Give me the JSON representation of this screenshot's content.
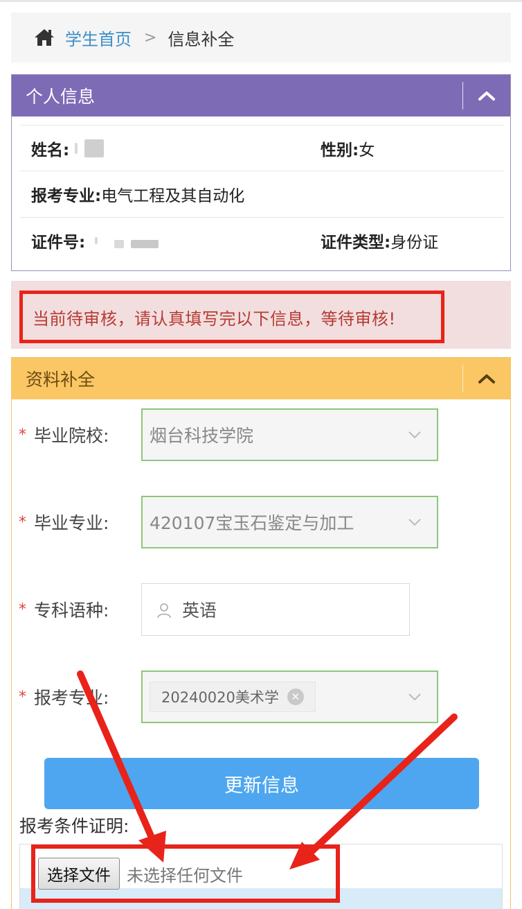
{
  "breadcrumb": {
    "home_icon": "home-icon",
    "home_label": "学生首页",
    "separator": ">",
    "current": "信息补全"
  },
  "personal_panel": {
    "title": "个人信息",
    "name_label": "姓名:",
    "gender_label": "性别:",
    "gender_value": "女",
    "major_label": "报考专业:",
    "major_value": "电气工程及其自动化",
    "id_label": "证件号:",
    "id_type_label": "证件类型:",
    "id_type_value": "身份证"
  },
  "alert": {
    "message": "当前待审核，请认真填写完以下信息，等待审核!"
  },
  "supplement_panel": {
    "title": "资料补全",
    "fields": {
      "school_label": "毕业院校:",
      "school_value": "烟台科技学院",
      "grad_major_label": "毕业专业:",
      "grad_major_value": "420107宝玉石鉴定与加工",
      "language_label": "专科语种:",
      "language_value": "英语",
      "apply_major_label": "报考专业:",
      "apply_major_tag": "20240020美术学"
    },
    "required_mark": "*",
    "submit_label": "更新信息",
    "condition_label": "报考条件证明:",
    "file_button_label": "选择文件",
    "file_status": "未选择任何文件"
  },
  "colors": {
    "purple_header": "#7e6bb5",
    "yellow_header": "#fac764",
    "alert_bg": "#f2dede",
    "annotation_red": "#e8231a",
    "primary_button": "#4ea6f0",
    "link_blue": "#3b8fc9"
  }
}
